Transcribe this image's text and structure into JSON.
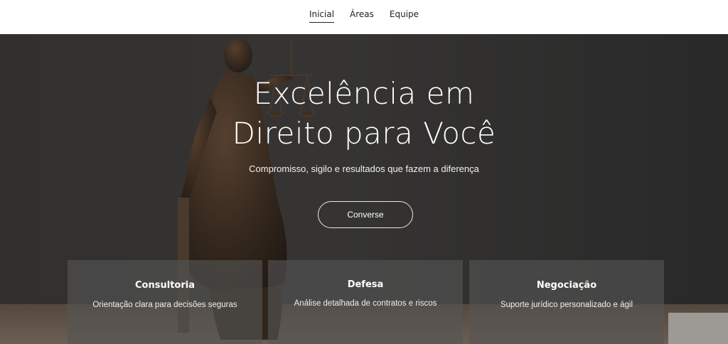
{
  "nav": {
    "items": [
      {
        "label": "Inicial",
        "active": true
      },
      {
        "label": "Áreas",
        "active": false
      },
      {
        "label": "Equipe",
        "active": false
      }
    ]
  },
  "hero": {
    "title_line1": "Excelência em",
    "title_line2": "Direito para Você",
    "subtitle": "Compromisso, sigilo e resultados que fazem a diferença",
    "cta_label": "Converse",
    "background_image": "lady-justice-statue"
  },
  "cards": [
    {
      "title": "Consultoria",
      "description": "Orientação clara para decisões seguras"
    },
    {
      "title": "Defesa",
      "description": "Análise detalhada de contratos e riscos"
    },
    {
      "title": "Negociação",
      "description": "Suporte jurídico personalizado e ágil"
    }
  ],
  "colors": {
    "nav_bg": "#ffffff",
    "hero_text": "#ffffff",
    "card_bg": "#555555"
  }
}
